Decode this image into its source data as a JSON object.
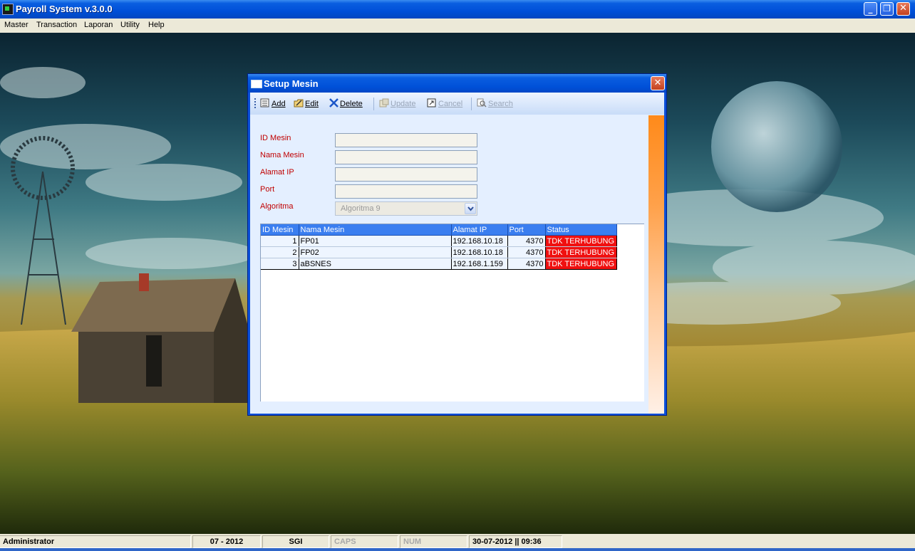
{
  "app": {
    "title": "Payroll System v.3.0.0"
  },
  "window_buttons": {
    "minimize": "_",
    "maximize": "❐",
    "close": "✕"
  },
  "menu": [
    "Master",
    "Transaction",
    "Laporan",
    "Utility",
    "Help"
  ],
  "dialog": {
    "title": "Setup Mesin",
    "close": "✕",
    "toolbar": {
      "add": "Add",
      "edit": "Edit",
      "delete": "Delete",
      "update": "Update",
      "cancel": "Cancel",
      "search": "Search"
    },
    "form": {
      "id_mesin": {
        "label": "ID Mesin",
        "value": ""
      },
      "nama_mesin": {
        "label": "Nama Mesin",
        "value": ""
      },
      "alamat_ip": {
        "label": "Alamat IP",
        "value": ""
      },
      "port": {
        "label": "Port",
        "value": ""
      },
      "algoritma": {
        "label": "Algoritma",
        "value": "Algoritma 9"
      }
    },
    "grid": {
      "columns": [
        "ID Mesin",
        "Nama Mesin",
        "Alamat IP",
        "Port",
        "Status"
      ],
      "rows": [
        {
          "id": "1",
          "nama": "FP01",
          "ip": "192.168.10.18",
          "port": "4370",
          "status": "TDK TERHUBUNG"
        },
        {
          "id": "2",
          "nama": "FP02",
          "ip": "192.168.10.18",
          "port": "4370",
          "status": "TDK TERHUBUNG"
        },
        {
          "id": "3",
          "nama": "aBSNES",
          "ip": "192.168.1.159",
          "port": "4370",
          "status": "TDK TERHUBUNG"
        }
      ]
    }
  },
  "statusbar": {
    "user": "Administrator",
    "period": "07 - 2012",
    "company": "SGI",
    "caps": "CAPS",
    "num": "NUM",
    "datetime": "30-07-2012 || 09:36"
  },
  "colors": {
    "title_blue": "#0050d8",
    "status_red": "#f01010",
    "label_red": "#c00000",
    "accent_orange": "#ff8a1a"
  }
}
